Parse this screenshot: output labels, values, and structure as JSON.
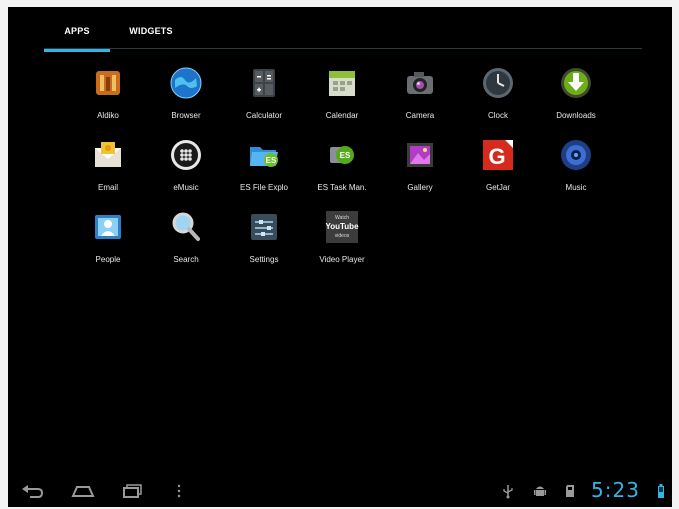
{
  "tabs": [
    {
      "label": "APPS",
      "active": true
    },
    {
      "label": "WIDGETS",
      "active": false
    }
  ],
  "accent_color": "#33b5e5",
  "apps": [
    {
      "label": "Aldiko",
      "icon": "aldiko-icon"
    },
    {
      "label": "Browser",
      "icon": "browser-globe-icon"
    },
    {
      "label": "Calculator",
      "icon": "calculator-icon"
    },
    {
      "label": "Calendar",
      "icon": "calendar-icon"
    },
    {
      "label": "Camera",
      "icon": "camera-icon"
    },
    {
      "label": "Clock",
      "icon": "clock-icon"
    },
    {
      "label": "Downloads",
      "icon": "downloads-icon"
    },
    {
      "label": "Email",
      "icon": "email-icon"
    },
    {
      "label": "eMusic",
      "icon": "emusic-icon"
    },
    {
      "label": "ES File Explo",
      "icon": "es-file-explorer-icon"
    },
    {
      "label": "ES Task Man.",
      "icon": "es-task-manager-icon"
    },
    {
      "label": "Gallery",
      "icon": "gallery-icon"
    },
    {
      "label": "GetJar",
      "icon": "getjar-icon"
    },
    {
      "label": "Music",
      "icon": "music-icon"
    },
    {
      "label": "People",
      "icon": "people-icon"
    },
    {
      "label": "Search",
      "icon": "search-icon"
    },
    {
      "label": "Settings",
      "icon": "settings-icon"
    },
    {
      "label": "Video Player",
      "icon": "video-player-icon",
      "icon_text": [
        "Watch",
        "YouTube",
        "videos"
      ]
    }
  ],
  "navbar": {
    "back_icon": "back-icon",
    "home_icon": "home-icon",
    "recents_icon": "recent-apps-icon",
    "menu_icon": "menu-icon"
  },
  "status": {
    "icons": [
      "usb-icon",
      "android-debug-icon",
      "sd-card-icon",
      "battery-icon"
    ],
    "time": "5:23"
  }
}
